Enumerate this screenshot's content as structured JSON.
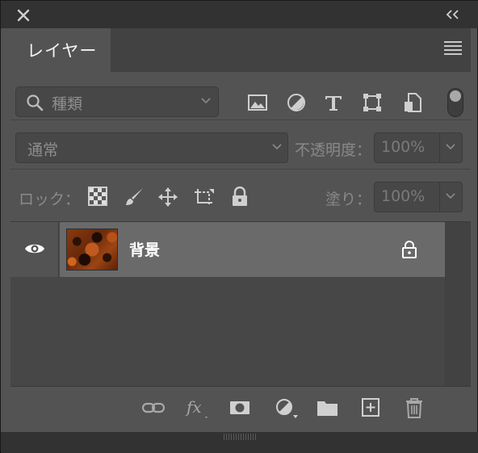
{
  "panel": {
    "tab_title": "レイヤー"
  },
  "filter": {
    "kind_label": "種類"
  },
  "blend": {
    "mode": "通常",
    "opacity_label": "不透明度：",
    "opacity_value": "100%"
  },
  "lock": {
    "label": "ロック：",
    "fill_label": "塗り：",
    "fill_value": "100%"
  },
  "layers": [
    {
      "name": "背景",
      "visible": true,
      "locked": true
    }
  ],
  "icons": {
    "close": "close-icon",
    "collapse": "double-chevron-left-icon",
    "panel_menu": "hamburger-menu-icon",
    "filter_image": "image-filter-icon",
    "filter_adjustment": "adjustment-filter-icon",
    "filter_type": "type-filter-icon",
    "filter_shape": "shape-filter-icon",
    "filter_smart": "smart-object-filter-icon",
    "lock_transparent": "checkerboard-icon",
    "lock_image": "brush-icon",
    "lock_position": "move-arrows-icon",
    "lock_artboard": "artboard-icon",
    "lock_all": "padlock-icon",
    "link_layers": "link-icon",
    "layer_style": "fx-icon",
    "add_mask": "mask-icon",
    "new_adjustment": "half-circle-icon",
    "new_group": "folder-icon",
    "new_layer": "new-layer-icon",
    "delete": "trash-icon"
  },
  "colors": {
    "panel_bg": "#535353",
    "selected_row": "#6a6a6a",
    "dark_strip": "#323232"
  }
}
